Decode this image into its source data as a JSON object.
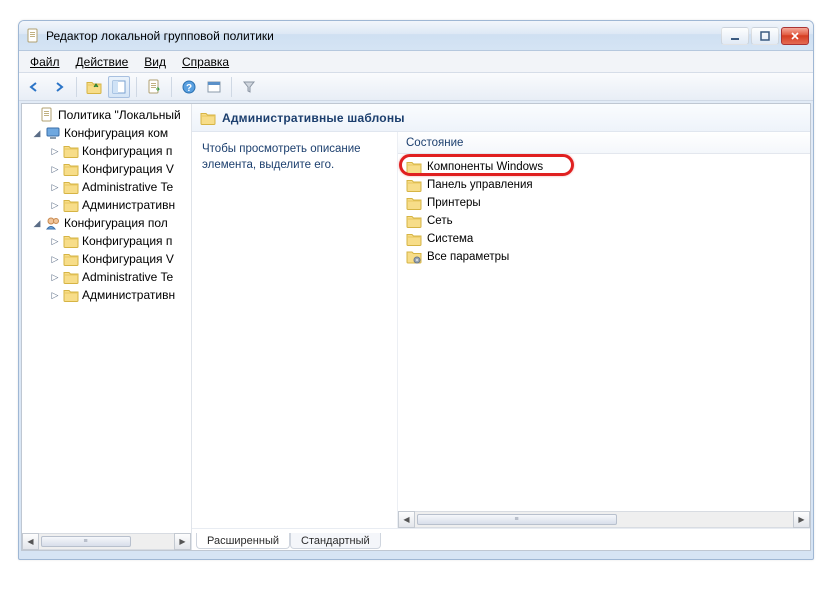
{
  "window": {
    "title": "Редактор локальной групповой политики"
  },
  "menu": {
    "file": "Файл",
    "action": "Действие",
    "view": "Вид",
    "help": "Справка"
  },
  "tree": {
    "root": "Политика \"Локальный",
    "comp": "Конфигурация ком",
    "user": "Конфигурация пол",
    "children": {
      "c0": "Конфигурация п",
      "c1": "Конфигурация V",
      "c2": "Administrative Te",
      "c3": "Административн"
    }
  },
  "heading": "Административные шаблоны",
  "description": "Чтобы просмотреть описание элемента, выделите его.",
  "column": "Состояние",
  "items": [
    "Компоненты Windows",
    "Панель управления",
    "Принтеры",
    "Сеть",
    "Система",
    "Все параметры"
  ],
  "tabs": {
    "extended": "Расширенный",
    "standard": "Стандартный"
  }
}
